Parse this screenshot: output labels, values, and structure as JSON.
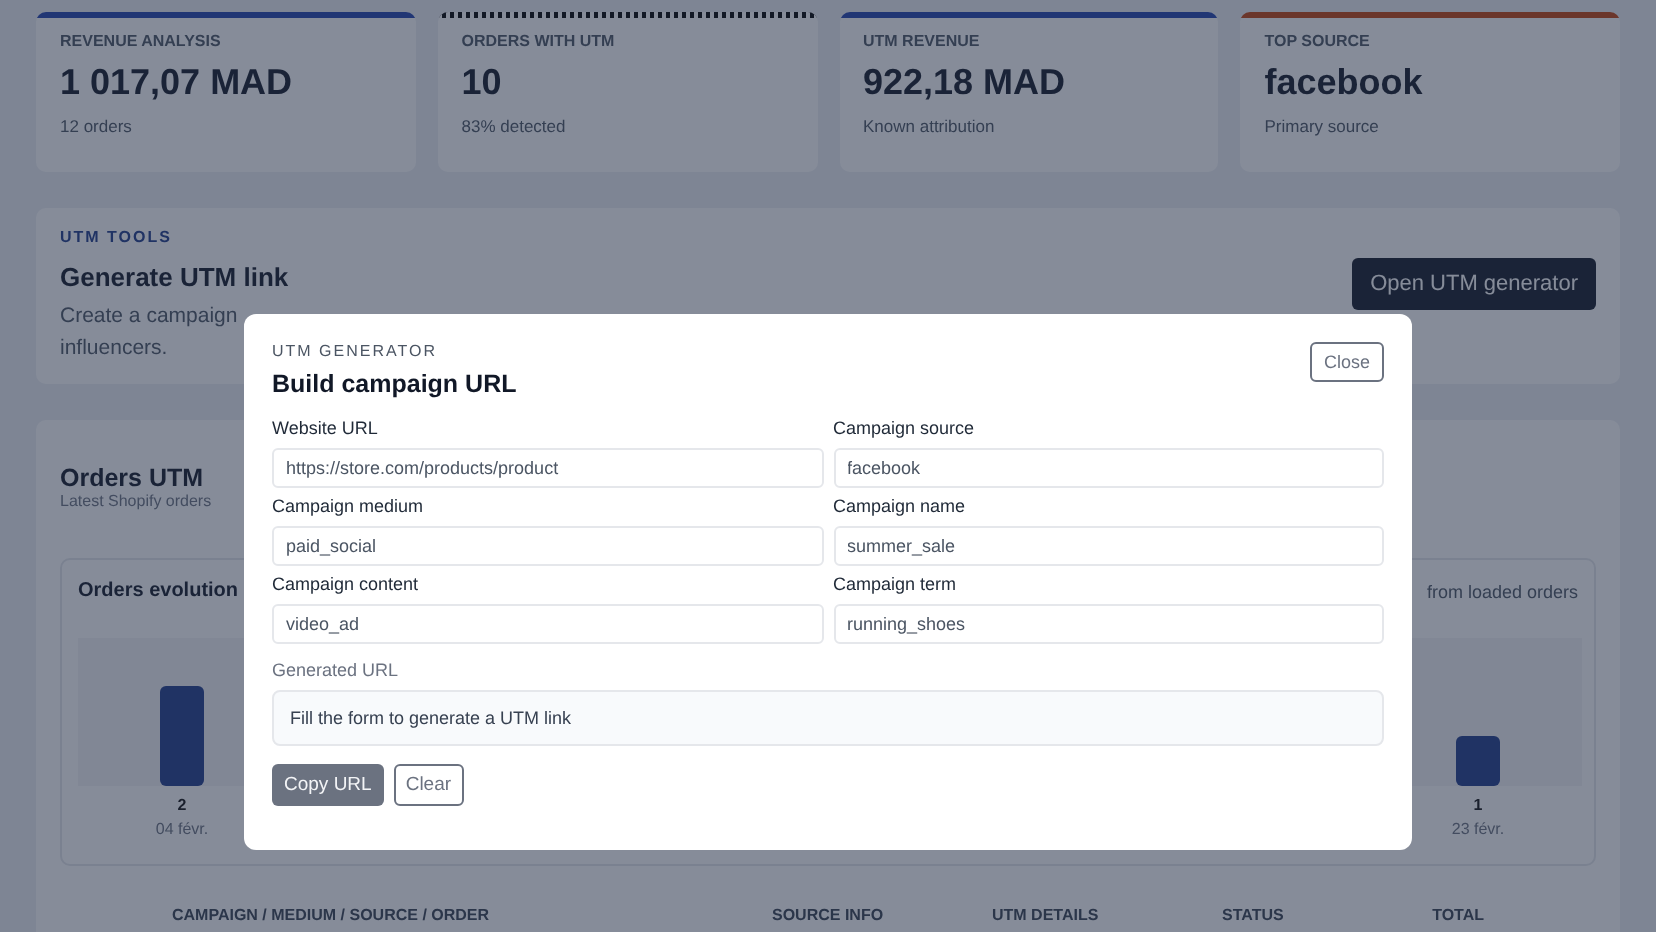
{
  "stats": [
    {
      "label": "REVENUE ANALYSIS",
      "value": "1 017,07 MAD",
      "sub": "12 orders",
      "color": "#213675",
      "kind": "solid"
    },
    {
      "label": "ORDERS WITH UTM",
      "value": "10",
      "sub": "83% detected",
      "color": "#131927",
      "kind": "dashed"
    },
    {
      "label": "UTM REVENUE",
      "value": "922,18 MAD",
      "sub": "Known attribution",
      "color": "#213675",
      "kind": "solid"
    },
    {
      "label": "TOP SOURCE",
      "value": "facebook",
      "sub": "Primary source",
      "color": "#6b362c",
      "kind": "solid"
    }
  ],
  "tools": {
    "eyebrow": "UTM TOOLS",
    "title": "Generate UTM link",
    "description_lines": [
      "Create a campaign",
      "influencers."
    ],
    "button": "Open UTM generator"
  },
  "orders": {
    "title": "Orders UTM",
    "subtitle": "Latest Shopify orders",
    "chart_title": "Orders evolution",
    "chart_note": "from loaded orders",
    "chart_data": {
      "type": "bar",
      "categories": [
        "04 févr.",
        "23 févr."
      ],
      "values": [
        2,
        1
      ],
      "data_labels": true
    },
    "columns": [
      "CAMPAIGN / MEDIUM / SOURCE / ORDER",
      "SOURCE INFO",
      "UTM DETAILS",
      "STATUS",
      "TOTAL"
    ]
  },
  "modal": {
    "eyebrow": "UTM GENERATOR",
    "title": "Build campaign URL",
    "close": "Close",
    "fields": [
      {
        "label": "Website URL",
        "placeholder": "https://store.com/products/product"
      },
      {
        "label": "Campaign source",
        "placeholder": "facebook"
      },
      {
        "label": "Campaign medium",
        "placeholder": "paid_social"
      },
      {
        "label": "Campaign name",
        "placeholder": "summer_sale"
      },
      {
        "label": "Campaign content",
        "placeholder": "video_ad"
      },
      {
        "label": "Campaign term",
        "placeholder": "running_shoes"
      }
    ],
    "generated_label": "Generated URL",
    "generated_text": "Fill the form to generate a UTM link",
    "copy_button": {
      "label": "Copy URL",
      "disabled": true
    },
    "clear_button": "Clear"
  }
}
